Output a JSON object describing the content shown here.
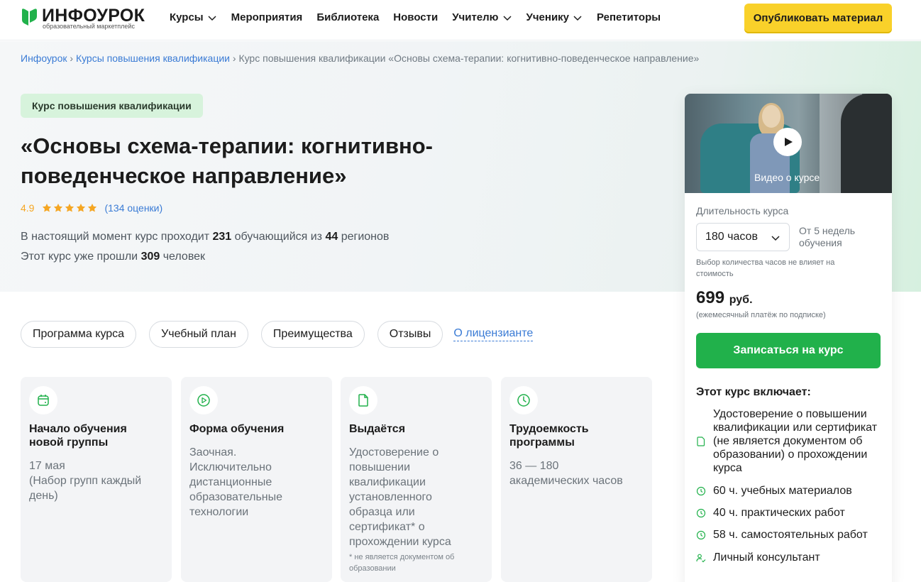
{
  "header": {
    "logo_text": "ИНФОУРОК",
    "logo_tagline": "образовательный маркетплейс",
    "nav": [
      {
        "label": "Курсы",
        "dropdown": true
      },
      {
        "label": "Мероприятия",
        "dropdown": false
      },
      {
        "label": "Библиотека",
        "dropdown": false
      },
      {
        "label": "Новости",
        "dropdown": false
      },
      {
        "label": "Учителю",
        "dropdown": true
      },
      {
        "label": "Ученику",
        "dropdown": true
      },
      {
        "label": "Репетиторы",
        "dropdown": false
      }
    ],
    "publish_label": "Опубликовать материал",
    "publish_color": "#f9d12a"
  },
  "breadcrumb": {
    "items": [
      "Инфоурок",
      "Курсы повышения квалификации"
    ],
    "separator": "›",
    "current": "Курс повышения квалификации «Основы схема-терапии: когнитивно-поведенческое направление»"
  },
  "course": {
    "badge": "Курс повышения квалификации",
    "title": "«Основы схема-терапии: когнитивно-поведенческое направление»",
    "rating_value": "4.9",
    "stars": 5,
    "rating_count": "(134 оценки)",
    "stat1": {
      "pre": "В настоящий момент курс проходит ",
      "num1": "231",
      "mid": " обучающийся из ",
      "num2": "44",
      "post": " регионов"
    },
    "stat2": {
      "pre": "Этот курс уже прошли ",
      "num": "309",
      "post": " человек"
    }
  },
  "tabs": [
    "Программа курса",
    "Учебный план",
    "Преимущества",
    "Отзывы"
  ],
  "tab_link": "О лицензианте",
  "cards": [
    {
      "icon": "calendar-icon",
      "title": "Начало обучения новой группы",
      "text": "17 мая\n(Набор групп каждый день)",
      "note": ""
    },
    {
      "icon": "play-circle-icon",
      "title": "Форма обучения",
      "text": "Заочная. Исключительно дистанционные образовательные технологии",
      "note": ""
    },
    {
      "icon": "document-icon",
      "title": "Выдаётся",
      "text": "Удостоверение о повышении квалификации установленного образца или сертификат* о прохождении курса",
      "note": "* не является документом об образовании"
    },
    {
      "icon": "clock-icon",
      "title": "Трудоемкость программы",
      "text": "36 — 180 академических часов",
      "note": ""
    }
  ],
  "sidebar": {
    "video_label": "Видео о курсе",
    "duration_label": "Длительность курса",
    "hours_value": "180 часов",
    "weeks": "От 5 недель обучения",
    "hours_note": "Выбор количества часов не влияет на стоимость",
    "price": "699",
    "currency": "руб.",
    "price_note": "(ежемесячный платёж по подписке)",
    "enroll_label": "Записаться на курс",
    "enroll_color": "#21b14b",
    "includes_title": "Этот курс включает:",
    "includes": [
      {
        "icon": "document-icon",
        "text": "Удостоверение о повышении квалификации или сертификат (не является документом об образовании) о прохождении курса"
      },
      {
        "icon": "clock-icon",
        "text": "60 ч. учебных материалов"
      },
      {
        "icon": "clock-icon",
        "text": "40 ч. практических работ"
      },
      {
        "icon": "clock-icon",
        "text": "58 ч. самостоятельных работ"
      },
      {
        "icon": "user-check-icon",
        "text": "Личный консультант"
      }
    ]
  },
  "colors": {
    "accent_green": "#21b14b",
    "link_blue": "#3a7bd5",
    "rating_orange": "#f5a623"
  }
}
